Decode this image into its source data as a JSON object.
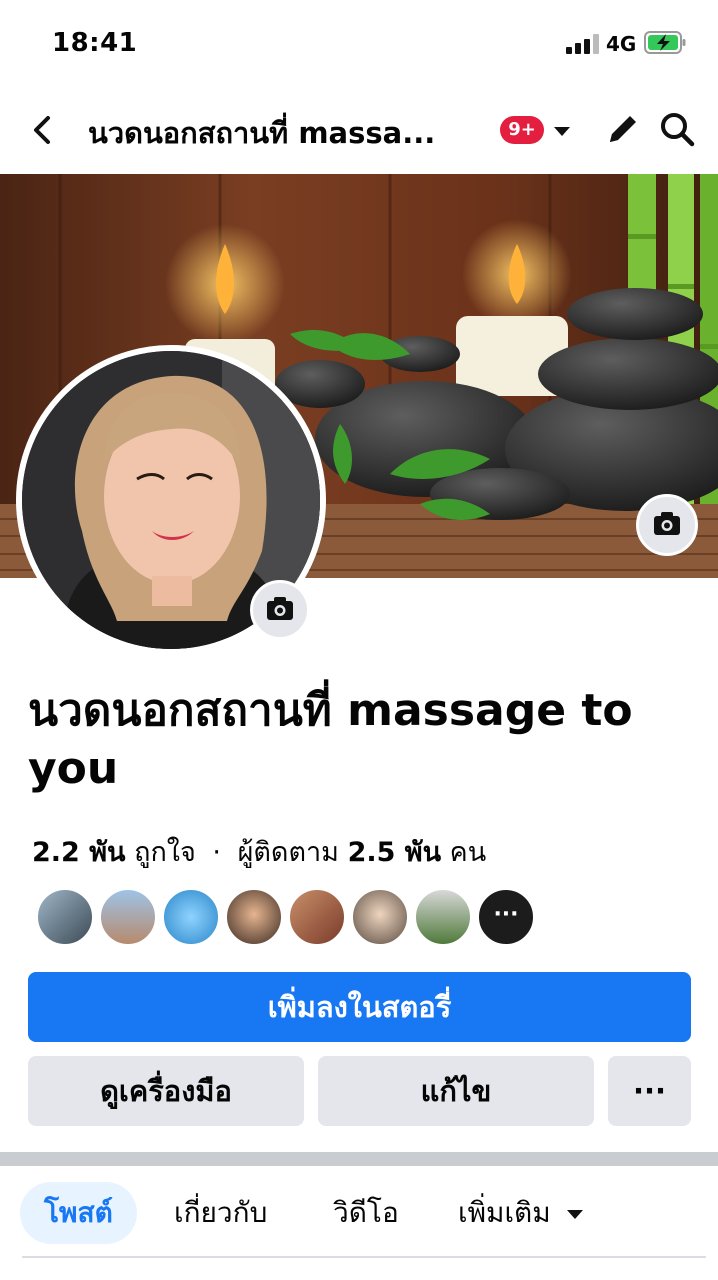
{
  "status_bar": {
    "time": "18:41",
    "network": "4G",
    "battery_icon": "battery-charging-icon"
  },
  "header": {
    "title": "นวดนอกสถานที่ massa...",
    "badge": "9+",
    "back_icon": "chevron-left-icon",
    "edit_icon": "pencil-icon",
    "search_icon": "search-icon"
  },
  "profile": {
    "name": "นวดนอกสถานที่ massage to you",
    "likes_count": "2.2 พัน",
    "likes_label": "ถูกใจ",
    "separator": "·",
    "followers_label": "ผู้ติดตาม",
    "followers_count": "2.5 พัน",
    "followers_unit": "คน",
    "more_friends": "···"
  },
  "actions": {
    "add_story": "เพิ่มลงในสตอรี่",
    "view_tools": "ดูเครื่องมือ",
    "edit": "แก้ไข",
    "more": "···"
  },
  "tabs": [
    {
      "label": "โพสต์",
      "active": true
    },
    {
      "label": "เกี่ยวกับ",
      "active": false
    },
    {
      "label": "วิดีโอ",
      "active": false
    },
    {
      "label": "เพิ่มเติม",
      "active": false
    }
  ],
  "colors": {
    "primary": "#1877f2",
    "badge": "#e41e3f",
    "secondary_button": "#e4e6eb",
    "divider": "#c9ccd1",
    "tab_active_bg": "#e7f3ff"
  }
}
